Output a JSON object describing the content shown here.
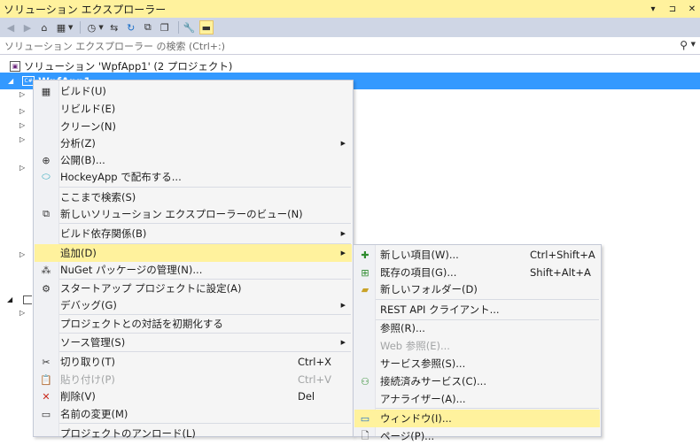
{
  "window": {
    "title": "ソリューション エクスプローラー",
    "buttons": [
      "▾",
      "⊐",
      "✕"
    ]
  },
  "toolbar": {
    "back_icon": "back-arrow-icon",
    "forward_icon": "forward-arrow-icon",
    "home_icon": "home-icon"
  },
  "search": {
    "placeholder": "ソリューション エクスプローラー の検索 (Ctrl+:)"
  },
  "tree": {
    "solution_label": "ソリューション 'WpfApp1' (2 プロジェクト)",
    "project_label": "WpfApp1",
    "project_icon_text": "C#"
  },
  "context_menu": {
    "items": [
      {
        "label": "ビルド(U)",
        "shortcut": "",
        "submenu": false,
        "disabled": false,
        "icon": "build-icon"
      },
      {
        "label": "リビルド(E)",
        "shortcut": "",
        "submenu": false,
        "disabled": false,
        "icon": ""
      },
      {
        "label": "クリーン(N)",
        "shortcut": "",
        "submenu": false,
        "disabled": false,
        "icon": ""
      },
      {
        "label": "分析(Z)",
        "shortcut": "",
        "submenu": true,
        "disabled": false,
        "icon": ""
      },
      {
        "label": "公開(B)...",
        "shortcut": "",
        "submenu": false,
        "disabled": false,
        "icon": "globe-icon"
      },
      {
        "label": "HockeyApp で配布する...",
        "shortcut": "",
        "submenu": false,
        "disabled": false,
        "icon": "hockeyapp-icon"
      },
      {
        "label": "ここまで検索(S)",
        "shortcut": "",
        "submenu": false,
        "disabled": false,
        "icon": ""
      },
      {
        "label": "新しいソリューション エクスプローラーのビュー(N)",
        "shortcut": "",
        "submenu": false,
        "disabled": false,
        "icon": "new-view-icon"
      },
      {
        "label": "ビルド依存関係(B)",
        "shortcut": "",
        "submenu": true,
        "disabled": false,
        "icon": ""
      },
      {
        "label": "追加(D)",
        "shortcut": "",
        "submenu": true,
        "disabled": false,
        "icon": ""
      },
      {
        "label": "NuGet パッケージの管理(N)...",
        "shortcut": "",
        "submenu": false,
        "disabled": false,
        "icon": "nuget-icon"
      },
      {
        "label": "スタートアップ プロジェクトに設定(A)",
        "shortcut": "",
        "submenu": false,
        "disabled": false,
        "icon": "gear-icon"
      },
      {
        "label": "デバッグ(G)",
        "shortcut": "",
        "submenu": true,
        "disabled": false,
        "icon": ""
      },
      {
        "label": "プロジェクトとの対話を初期化する",
        "shortcut": "",
        "submenu": false,
        "disabled": false,
        "icon": ""
      },
      {
        "label": "ソース管理(S)",
        "shortcut": "",
        "submenu": true,
        "disabled": false,
        "icon": ""
      },
      {
        "label": "切り取り(T)",
        "shortcut": "Ctrl+X",
        "submenu": false,
        "disabled": false,
        "icon": "scissors-icon"
      },
      {
        "label": "貼り付け(P)",
        "shortcut": "Ctrl+V",
        "submenu": false,
        "disabled": true,
        "icon": "paste-icon"
      },
      {
        "label": "削除(V)",
        "shortcut": "Del",
        "submenu": false,
        "disabled": false,
        "icon": "delete-icon"
      },
      {
        "label": "名前の変更(M)",
        "shortcut": "",
        "submenu": false,
        "disabled": false,
        "icon": "rename-icon"
      },
      {
        "label": "プロジェクトのアンロード(L)",
        "shortcut": "",
        "submenu": false,
        "disabled": false,
        "icon": ""
      }
    ]
  },
  "add_submenu": {
    "items": [
      {
        "label": "新しい項目(W)...",
        "shortcut": "Ctrl+Shift+A",
        "disabled": false,
        "icon": "new-item-icon"
      },
      {
        "label": "既存の項目(G)...",
        "shortcut": "Shift+Alt+A",
        "disabled": false,
        "icon": "existing-item-icon"
      },
      {
        "label": "新しいフォルダー(D)",
        "shortcut": "",
        "disabled": false,
        "icon": "new-folder-icon"
      },
      {
        "label": "REST API クライアント...",
        "shortcut": "",
        "disabled": false,
        "icon": ""
      },
      {
        "label": "参照(R)...",
        "shortcut": "",
        "disabled": false,
        "icon": ""
      },
      {
        "label": "Web 参照(E)...",
        "shortcut": "",
        "disabled": true,
        "icon": ""
      },
      {
        "label": "サービス参照(S)...",
        "shortcut": "",
        "disabled": false,
        "icon": ""
      },
      {
        "label": "接続済みサービス(C)...",
        "shortcut": "",
        "disabled": false,
        "icon": "connected-service-icon"
      },
      {
        "label": "アナライザー(A)...",
        "shortcut": "",
        "disabled": false,
        "icon": ""
      },
      {
        "label": "ウィンドウ(I)...",
        "shortcut": "",
        "disabled": false,
        "icon": "window-icon"
      },
      {
        "label": "ページ(P)...",
        "shortcut": "",
        "disabled": false,
        "icon": "page-icon"
      }
    ]
  },
  "colors": {
    "title_bg": "#fff29d",
    "toolbar_bg": "#cfd6e5",
    "selection": "#3399ff",
    "highlight": "#fff29d"
  }
}
